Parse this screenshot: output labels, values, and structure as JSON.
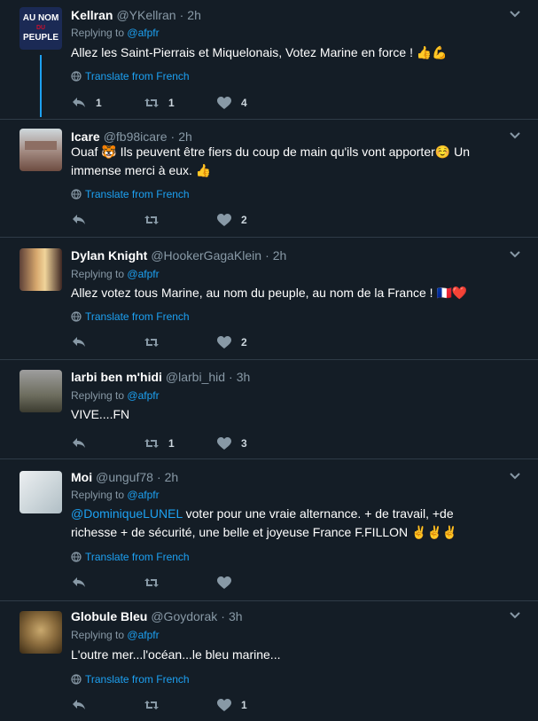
{
  "ui": {
    "translate_label": "Translate from French",
    "replying_prefix": "Replying to",
    "colors": {
      "background": "#141d26",
      "accent": "#1da1f2",
      "muted": "#8899a6",
      "divider": "#2f3b47"
    }
  },
  "tweets": [
    {
      "name": "Kellran",
      "handle": "@YKellran",
      "time": "2h",
      "replying_to": "@afpfr",
      "text": "Allez les Saint-Pierrais et Miquelonais,  Votez Marine en force ! 👍💪",
      "has_translate": true,
      "counts": {
        "reply": "1",
        "retweet": "1",
        "like": "4"
      },
      "avatar_text": {
        "line1": "AU NOM",
        "line2": "DU",
        "line3": "PEUPLE"
      }
    },
    {
      "name": "Icare",
      "handle": "@fb98icare",
      "time": "2h",
      "replying_to": "",
      "text_prefix": "Ouaf 🐯 Ils peuvent être fiers du coup de main qu'ils vont apporter☺️ Un immense merci à eux. 👍",
      "has_translate": true,
      "counts": {
        "reply": "",
        "retweet": "",
        "like": "2"
      }
    },
    {
      "name": "Dylan Knight",
      "handle": "@HookerGagaKlein",
      "time": "2h",
      "replying_to": "@afpfr",
      "text": "Allez votez tous Marine, au nom du peuple, au nom de la France ! 🇫🇷❤️",
      "has_translate": true,
      "counts": {
        "reply": "",
        "retweet": "",
        "like": "2"
      }
    },
    {
      "name": "larbi ben m'hidi",
      "handle": "@larbi_hid",
      "time": "3h",
      "replying_to": "@afpfr",
      "text": "VIVE....FN",
      "has_translate": false,
      "counts": {
        "reply": "",
        "retweet": "1",
        "like": "3"
      }
    },
    {
      "name": "Moi",
      "handle": "@unguf78",
      "time": "2h",
      "replying_to": "@afpfr",
      "mention": "@DominiqueLUNEL",
      "text": " voter pour une vraie alternance.  + de travail, +de richesse + de sécurité, une belle et joyeuse France  F.FILLON ✌️✌️✌️",
      "has_translate": true,
      "counts": {
        "reply": "",
        "retweet": "",
        "like": ""
      }
    },
    {
      "name": "Globule Bleu",
      "handle": "@Goydorak",
      "time": "3h",
      "replying_to": "@afpfr",
      "text": "L'outre mer...l'océan...le bleu marine...",
      "has_translate": true,
      "counts": {
        "reply": "",
        "retweet": "",
        "like": "1"
      }
    }
  ]
}
